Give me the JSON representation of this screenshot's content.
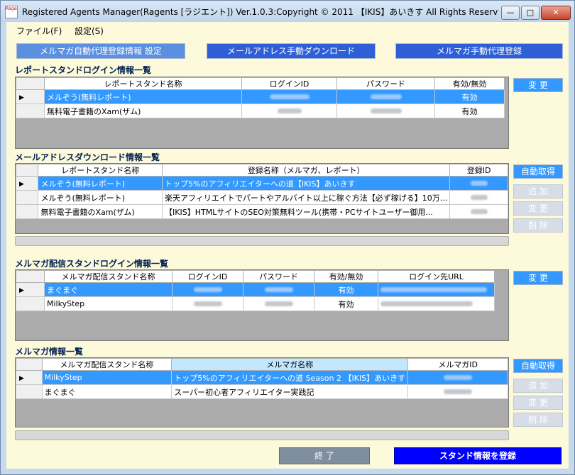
{
  "window": {
    "title": "Registered Agents Manager(Ragents [ラジエント]) Ver.1.0.3:Copyright © 2011 【IKIS】あいきす All Rights Reserv...",
    "icon_text": "Ragents",
    "min": "—",
    "max": "□",
    "close": "✕"
  },
  "menu": {
    "file": "ファイル(F)",
    "settings": "設定(S)"
  },
  "top_buttons": {
    "b1": "メルマガ自動代理登録情報 設定",
    "b2": "メールアドレス手動ダウンロード",
    "b3": "メルマガ手動代理登録"
  },
  "s1": {
    "title": "レポートスタンドログイン情報一覧",
    "headers": [
      "レポートスタンド名称",
      "ログインID",
      "パスワード",
      "有効/無効"
    ],
    "rows": [
      {
        "name": "メルぞう(無料レポート)",
        "status": "有効",
        "selected": true
      },
      {
        "name": "無料電子書籍のXam(ザム)",
        "status": "有効",
        "selected": false
      }
    ],
    "btn_update": "変 更"
  },
  "s2": {
    "title": "メールアドレスダウンロード情報一覧",
    "headers": [
      "レポートスタンド名称",
      "登録名称（メルマガ、レポート）",
      "登録ID"
    ],
    "rows": [
      {
        "name": "メルぞう(無料レポート)",
        "reg": "トップ5%のアフィリエイターへの道【IKIS】あいきす",
        "selected": true
      },
      {
        "name": "メルぞう(無料レポート)",
        "reg": "楽天アフィリエイトでパートやアルバイト以上に稼ぐ方法【必ず稼げる】10万...",
        "selected": false
      },
      {
        "name": "無料電子書籍のXam(ザム)",
        "reg": "【IKIS】HTMLサイトのSEO対策無料ツール(携帯・PCサイトユーザー御用...",
        "selected": false
      }
    ],
    "btn_auto": "自動取得",
    "btn_add": "追 加",
    "btn_update": "変 更",
    "btn_delete": "削 除"
  },
  "s3": {
    "title": "メルマガ配信スタンドログイン情報一覧",
    "headers": [
      "メルマガ配信スタンド名称",
      "ログインID",
      "パスワード",
      "有効/無効",
      "ログイン先URL"
    ],
    "rows": [
      {
        "name": "まぐまぐ",
        "status": "有効",
        "selected": true
      },
      {
        "name": "MilkyStep",
        "status": "有効",
        "selected": false
      }
    ],
    "btn_update": "変 更"
  },
  "s4": {
    "title": "メルマガ情報一覧",
    "headers": [
      "メルマガ配信スタンド名称",
      "メルマガ名称",
      "メルマガID"
    ],
    "rows": [
      {
        "name": "MilkyStep",
        "mag": "トップ5%のアフィリエイターへの道 Season 2 【IKIS】あいきす",
        "selected": true
      },
      {
        "name": "まぐまぐ",
        "mag": "スーパー初心者アフィリエイター実践記",
        "selected": false
      }
    ],
    "btn_auto": "自動取得",
    "btn_add": "追 加",
    "btn_update": "変 更",
    "btn_delete": "削 除"
  },
  "bottom": {
    "exit": "終 了",
    "register": "スタンド情報を登録"
  },
  "colors": {
    "selection": "#3399ff",
    "client_bg": "#fdfadc",
    "register_btn": "#0000ff",
    "section_title": "#002050"
  }
}
